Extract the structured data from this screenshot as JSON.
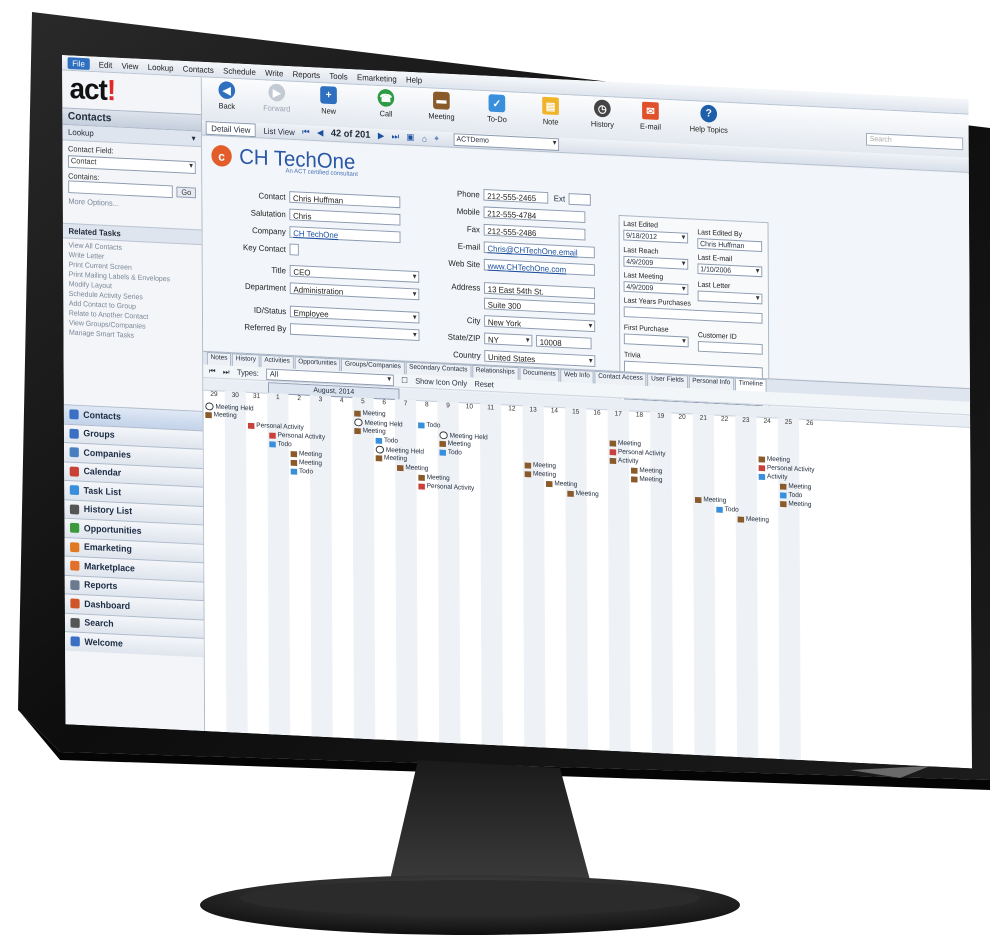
{
  "menu": [
    "File",
    "Edit",
    "View",
    "Lookup",
    "Contacts",
    "Schedule",
    "Write",
    "Reports",
    "Tools",
    "Emarketing",
    "Help"
  ],
  "logo": {
    "text": "act",
    "bang": "!"
  },
  "left": {
    "header": "Contacts",
    "lookup_label": "Lookup",
    "contact_field_label": "Contact Field:",
    "contact_field_value": "Contact",
    "contains_label": "Contains:",
    "go": "Go",
    "more_options": "More Options...",
    "related_tasks_header": "Related Tasks",
    "related_tasks": [
      "View All Contacts",
      "Write Letter",
      "Print Current Screen",
      "Print Mailing Labels & Envelopes",
      "Modify Layout",
      "Schedule Activity Series",
      "Add Contact to Group",
      "Relate to Another Contact",
      "View Groups/Companies",
      "Manage Smart Tasks"
    ]
  },
  "nav": [
    {
      "label": "Contacts",
      "icon": "contacts-icon",
      "color": "#3a6fc4"
    },
    {
      "label": "Groups",
      "icon": "groups-icon",
      "color": "#3a6fc4"
    },
    {
      "label": "Companies",
      "icon": "companies-icon",
      "color": "#4a7fbf"
    },
    {
      "label": "Calendar",
      "icon": "calendar-icon",
      "color": "#c94034"
    },
    {
      "label": "Task List",
      "icon": "task-list-icon",
      "color": "#3a8fdc"
    },
    {
      "label": "History List",
      "icon": "history-icon",
      "color": "#555555"
    },
    {
      "label": "Opportunities",
      "icon": "opportunities-icon",
      "color": "#3c9a3c"
    },
    {
      "label": "Emarketing",
      "icon": "emarketing-icon",
      "color": "#e07a22"
    },
    {
      "label": "Marketplace",
      "icon": "marketplace-icon",
      "color": "#e0702a"
    },
    {
      "label": "Reports",
      "icon": "reports-icon",
      "color": "#6b7a8f"
    },
    {
      "label": "Dashboard",
      "icon": "dashboard-icon",
      "color": "#d0562a"
    },
    {
      "label": "Search",
      "icon": "search-icon",
      "color": "#555555"
    },
    {
      "label": "Welcome",
      "icon": "welcome-icon",
      "color": "#3a6fc4"
    }
  ],
  "toolbar": {
    "back": "Back",
    "forward": "Forward",
    "new": "New",
    "call": "Call",
    "meeting": "Meeting",
    "todo": "To-Do",
    "note": "Note",
    "history": "History",
    "email": "E-mail",
    "help": "Help Topics",
    "search_placeholder": "Search"
  },
  "viewbar": {
    "detail_view": "Detail View",
    "list_view": "List View",
    "record_count": "42 of 201",
    "lookup_name": "ACTDemo"
  },
  "brand": {
    "name": "CH TechOne",
    "tagline": "An ACT certified consultant"
  },
  "fields": {
    "contact_label": "Contact",
    "contact": "Chris Huffman",
    "salutation_label": "Salutation",
    "salutation": "Chris",
    "company_label": "Company",
    "company": "CH TechOne",
    "key_contact_label": "Key Contact",
    "title_label": "Title",
    "title": "CEO",
    "department_label": "Department",
    "department": "Administration",
    "id_status_label": "ID/Status",
    "id_status": "Employee",
    "referred_by_label": "Referred By",
    "referred_by": "",
    "phone_label": "Phone",
    "phone": "212-555-2465",
    "ext_label": "Ext",
    "mobile_label": "Mobile",
    "mobile": "212-555-4784",
    "fax_label": "Fax",
    "fax": "212-555-2486",
    "email_label": "E-mail",
    "email": "Chris@CHTechOne.email",
    "website_label": "Web Site",
    "website": "www.CHTechOne.com",
    "address_label": "Address",
    "address1": "13 East 54th St.",
    "address2": "Suite 300",
    "city_label": "City",
    "city": "New York",
    "state_zip_label": "State/ZIP",
    "state": "NY",
    "zip": "10008",
    "country_label": "Country",
    "country": "United States"
  },
  "side": {
    "last_edited_label": "Last Edited",
    "last_edited": "9/18/2012",
    "last_edited_by_label": "Last Edited By",
    "last_edited_by": "Chris Huffman",
    "last_reach_label": "Last Reach",
    "last_reach": "4/9/2009",
    "last_email_label": "Last E-mail",
    "last_email": "1/10/2006",
    "last_meeting_label": "Last Meeting",
    "last_meeting": "4/9/2009",
    "last_letter_label": "Last Letter",
    "last_years_purchases_label": "Last Years Purchases",
    "first_purchase_label": "First Purchase",
    "customer_id_label": "Customer ID",
    "trivia_label": "Trivia"
  },
  "tabs": [
    "Notes",
    "History",
    "Activities",
    "Opportunities",
    "Groups/Companies",
    "Secondary Contacts",
    "Relationships",
    "Documents",
    "Web Info",
    "Contact Access",
    "User Fields",
    "Personal Info",
    "Timeline"
  ],
  "types_bar": {
    "label": "Types:",
    "value": "All",
    "show_icon_only": "Show Icon Only",
    "reset": "Reset"
  },
  "timeline": {
    "month": "August, 2014",
    "days": [
      "29",
      "30",
      "31",
      "1",
      "2",
      "3",
      "4",
      "5",
      "6",
      "7",
      "8",
      "9",
      "10",
      "11",
      "12",
      "13",
      "14",
      "15",
      "16",
      "17",
      "18",
      "19",
      "20",
      "21",
      "22",
      "23",
      "24",
      "25",
      "26"
    ],
    "events": [
      {
        "day": 0,
        "row": 0,
        "type": "held",
        "text": "Meeting Held"
      },
      {
        "day": 0,
        "row": 1,
        "type": "meet",
        "text": "Meeting"
      },
      {
        "day": 2,
        "row": 2,
        "type": "act",
        "text": "Personal Activity"
      },
      {
        "day": 3,
        "row": 3,
        "type": "act",
        "text": "Personal Activity"
      },
      {
        "day": 3,
        "row": 4,
        "type": "todo",
        "text": "Todo"
      },
      {
        "day": 4,
        "row": 5,
        "type": "meet",
        "text": "Meeting"
      },
      {
        "day": 4,
        "row": 6,
        "type": "meet",
        "text": "Meeting"
      },
      {
        "day": 4,
        "row": 7,
        "type": "todo",
        "text": "Todo"
      },
      {
        "day": 7,
        "row": 0,
        "type": "meet",
        "text": "Meeting"
      },
      {
        "day": 7,
        "row": 1,
        "type": "held",
        "text": "Meeting Held"
      },
      {
        "day": 7,
        "row": 2,
        "type": "meet",
        "text": "Meeting"
      },
      {
        "day": 8,
        "row": 3,
        "type": "todo",
        "text": "Todo"
      },
      {
        "day": 8,
        "row": 4,
        "type": "held",
        "text": "Meeting Held"
      },
      {
        "day": 8,
        "row": 5,
        "type": "meet",
        "text": "Meeting"
      },
      {
        "day": 9,
        "row": 6,
        "type": "meet",
        "text": "Meeting"
      },
      {
        "day": 10,
        "row": 1,
        "type": "todo",
        "text": "Todo"
      },
      {
        "day": 11,
        "row": 2,
        "type": "held",
        "text": "Meeting Held"
      },
      {
        "day": 11,
        "row": 3,
        "type": "meet",
        "text": "Meeting"
      },
      {
        "day": 11,
        "row": 4,
        "type": "todo",
        "text": "Todo"
      },
      {
        "day": 10,
        "row": 7,
        "type": "meet",
        "text": "Meeting"
      },
      {
        "day": 10,
        "row": 8,
        "type": "act",
        "text": "Personal Activity"
      },
      {
        "day": 15,
        "row": 5,
        "type": "meet",
        "text": "Meeting"
      },
      {
        "day": 15,
        "row": 6,
        "type": "meet",
        "text": "Meeting"
      },
      {
        "day": 16,
        "row": 7,
        "type": "meet",
        "text": "Meeting"
      },
      {
        "day": 17,
        "row": 8,
        "type": "meet",
        "text": "Meeting"
      },
      {
        "day": 19,
        "row": 2,
        "type": "meet",
        "text": "Meeting"
      },
      {
        "day": 19,
        "row": 3,
        "type": "act",
        "text": "Personal Activity"
      },
      {
        "day": 19,
        "row": 4,
        "type": "meet",
        "text": "Activity"
      },
      {
        "day": 20,
        "row": 5,
        "type": "meet",
        "text": "Meeting"
      },
      {
        "day": 20,
        "row": 6,
        "type": "meet",
        "text": "Meeting"
      },
      {
        "day": 23,
        "row": 8,
        "type": "meet",
        "text": "Meeting"
      },
      {
        "day": 24,
        "row": 9,
        "type": "todo",
        "text": "Todo"
      },
      {
        "day": 25,
        "row": 10,
        "type": "meet",
        "text": "Meeting"
      },
      {
        "day": 26,
        "row": 3,
        "type": "meet",
        "text": "Meeting"
      },
      {
        "day": 26,
        "row": 4,
        "type": "act",
        "text": "Personal Activity"
      },
      {
        "day": 26,
        "row": 5,
        "type": "todo",
        "text": "Activity"
      },
      {
        "day": 27,
        "row": 6,
        "type": "meet",
        "text": "Meeting"
      },
      {
        "day": 27,
        "row": 7,
        "type": "todo",
        "text": "Todo"
      },
      {
        "day": 27,
        "row": 8,
        "type": "meet",
        "text": "Meeting"
      }
    ]
  }
}
